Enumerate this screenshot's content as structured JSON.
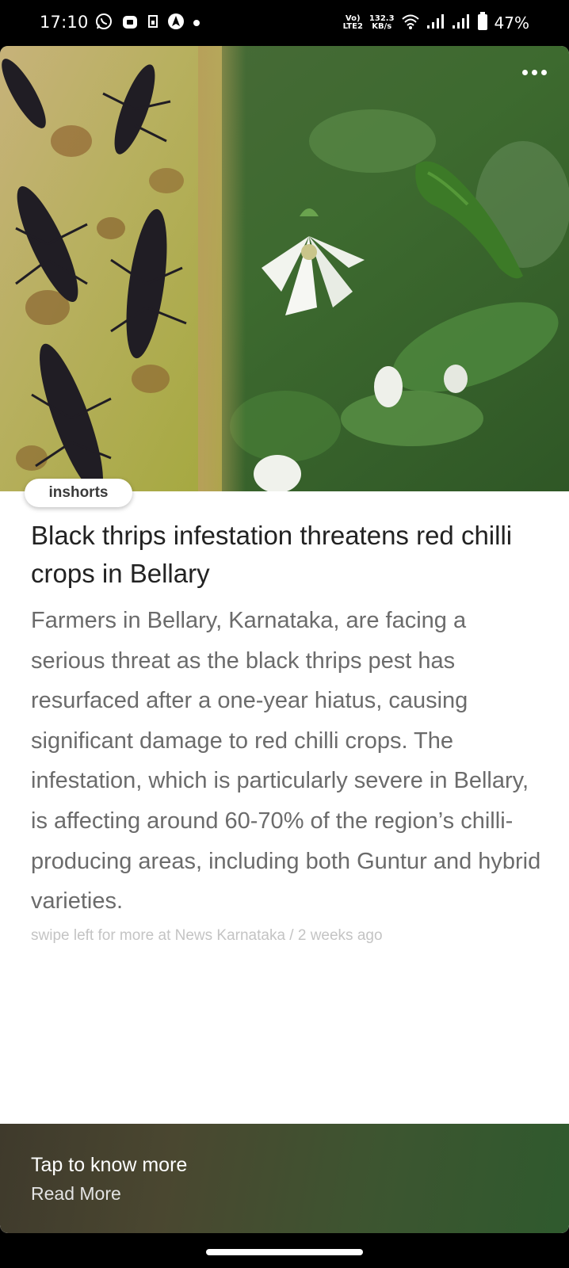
{
  "status_bar": {
    "time": "17:10",
    "network_label_top": "Vo)",
    "network_label_bottom": "LTE2",
    "speed_value": "132.3",
    "speed_unit": "KB/s",
    "battery": "47%"
  },
  "article": {
    "source_brand": "inshorts",
    "headline": "Black thrips infestation threatens red chilli crops in Bellary",
    "summary": "Farmers in Bellary, Karnataka, are facing a serious threat as the black thrips pest has resurfaced after a one-year hiatus, causing significant damage to red chilli crops. The infestation, which is particularly severe in Bellary, is affecting around 60-70% of the region’s chilli-producing areas, including both Guntur and hybrid varieties.",
    "source_line": "swipe left for more at News Karnataka / 2 weeks ago"
  },
  "footer": {
    "title": "Tap to know more",
    "subtitle": "Read More"
  },
  "icons": {
    "whatsapp": "whatsapp-icon",
    "bag": "shopping-bag-icon",
    "sim": "sim-icon",
    "navigation": "navigation-icon",
    "wifi": "wifi-icon",
    "signal": "signal-icon",
    "battery": "battery-icon",
    "more": "more-options-icon"
  }
}
